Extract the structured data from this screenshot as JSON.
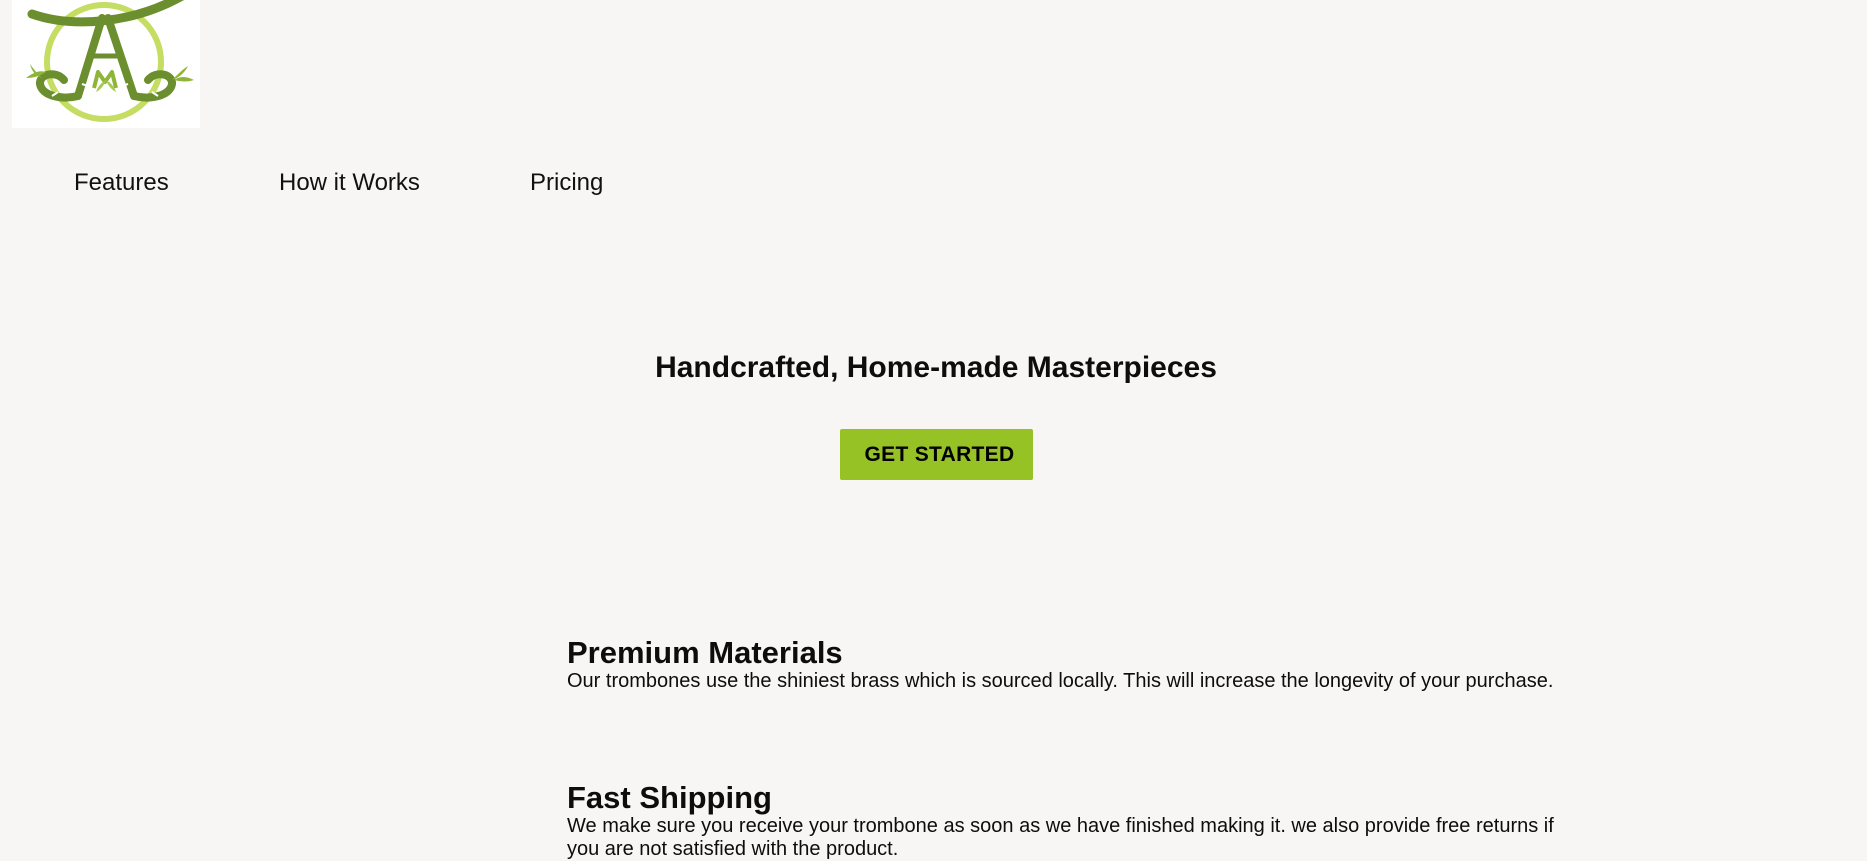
{
  "header": {
    "logo_icon": "bamboo-monogram-logo",
    "colors": {
      "logo_ring": "#c4dd62",
      "logo_bamboo": "#6b8e2e",
      "accent": "#97c225"
    }
  },
  "nav": {
    "items": [
      {
        "label": "Features"
      },
      {
        "label": "How it Works"
      },
      {
        "label": "Pricing"
      }
    ]
  },
  "hero": {
    "title": "Handcrafted, Home-made Masterpieces",
    "cta_label": "GET STARTED"
  },
  "features": [
    {
      "title": "Premium Materials",
      "description": "Our trombones use the shiniest brass which is sourced locally. This will increase the longevity of your purchase."
    },
    {
      "title": "Fast Shipping",
      "description": "We make sure you receive your trombone as soon as we have finished making it. we also provide free returns if you are not satisfied with the product."
    }
  ]
}
